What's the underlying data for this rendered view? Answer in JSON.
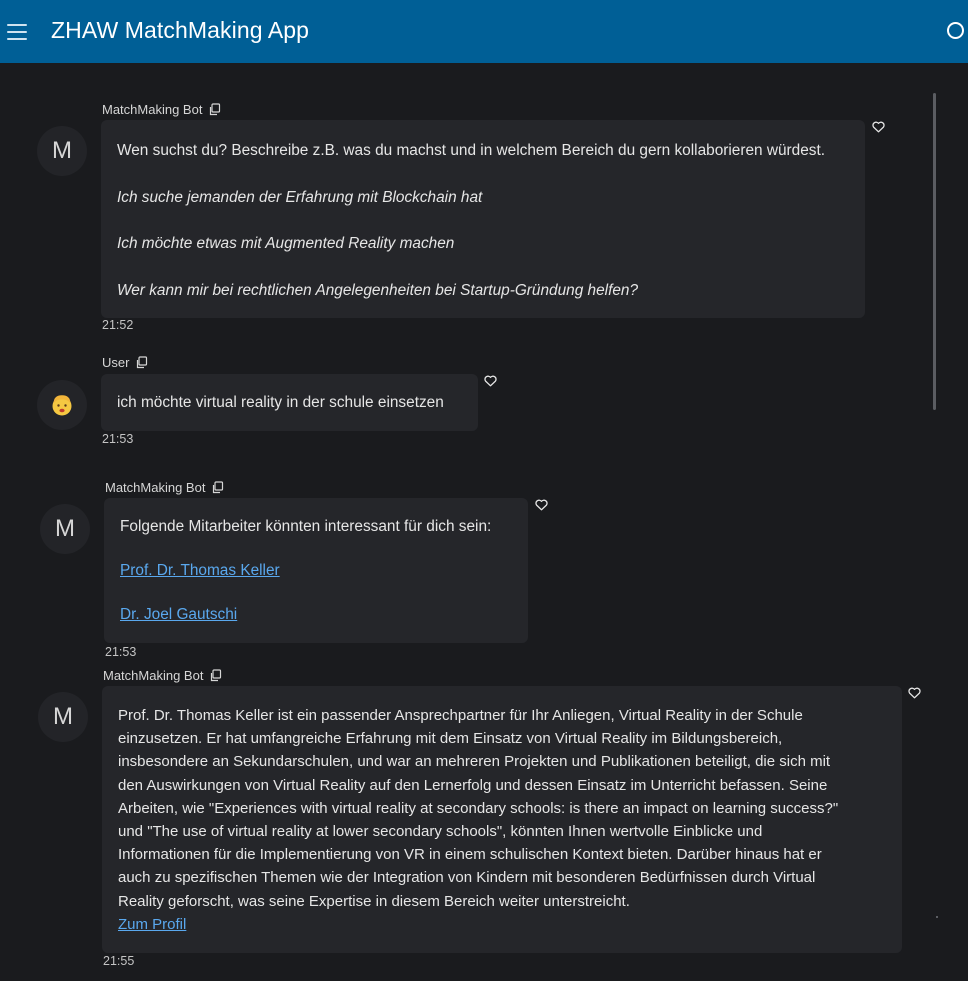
{
  "app": {
    "title": "ZHAW MatchMaking App"
  },
  "messages": [
    {
      "sender": "MatchMaking Bot",
      "avatar": "M",
      "intro": "Wen suchst du? Beschreibe z.B. was du machst und in welchem Bereich du gern kollaborieren würdest.",
      "examples": [
        "Ich suche jemanden der Erfahrung mit Blockchain hat",
        "Ich möchte etwas mit Augmented Reality machen",
        "Wer kann mir bei rechtlichen Angelegenheiten bei Startup-Gründung helfen?"
      ],
      "time": "21:52"
    },
    {
      "sender": "User",
      "avatar_icon": "face-emoji-icon",
      "text": "ich möchte virtual reality in der schule einsetzen",
      "time": "21:53"
    },
    {
      "sender": "MatchMaking Bot",
      "avatar": "M",
      "text": "Folgende Mitarbeiter könnten interessant für dich sein:",
      "links": [
        "Prof. Dr. Thomas Keller",
        "Dr. Joel Gautschi"
      ],
      "time": "21:53"
    },
    {
      "sender": "MatchMaking Bot",
      "avatar": "M",
      "lines": [
        "Prof. Dr. Thomas Keller ist ein passender Ansprechpartner für Ihr Anliegen, Virtual Reality in der Schule",
        "einzusetzen. Er hat umfangreiche Erfahrung mit dem Einsatz von Virtual Reality im Bildungsbereich,",
        "insbesondere an Sekundarschulen, und war an mehreren Projekten und Publikationen beteiligt, die sich mit",
        "den Auswirkungen von Virtual Reality auf den Lernerfolg und dessen Einsatz im Unterricht befassen. Seine",
        "Arbeiten, wie \"Experiences with virtual reality at secondary schools: is there an impact on learning success?\"",
        "und \"The use of virtual reality at lower secondary schools\", könnten Ihnen wertvolle Einblicke und",
        "Informationen für die Implementierung von VR in einem schulischen Kontext bieten. Darüber hinaus hat er",
        "auch zu spezifischen Themen wie der Integration von Kindern mit besonderen Bedürfnissen durch Virtual",
        "Reality geforscht, was seine Expertise in diesem Bereich weiter unterstreicht."
      ],
      "link": "Zum Profil",
      "time": "21:55"
    }
  ]
}
